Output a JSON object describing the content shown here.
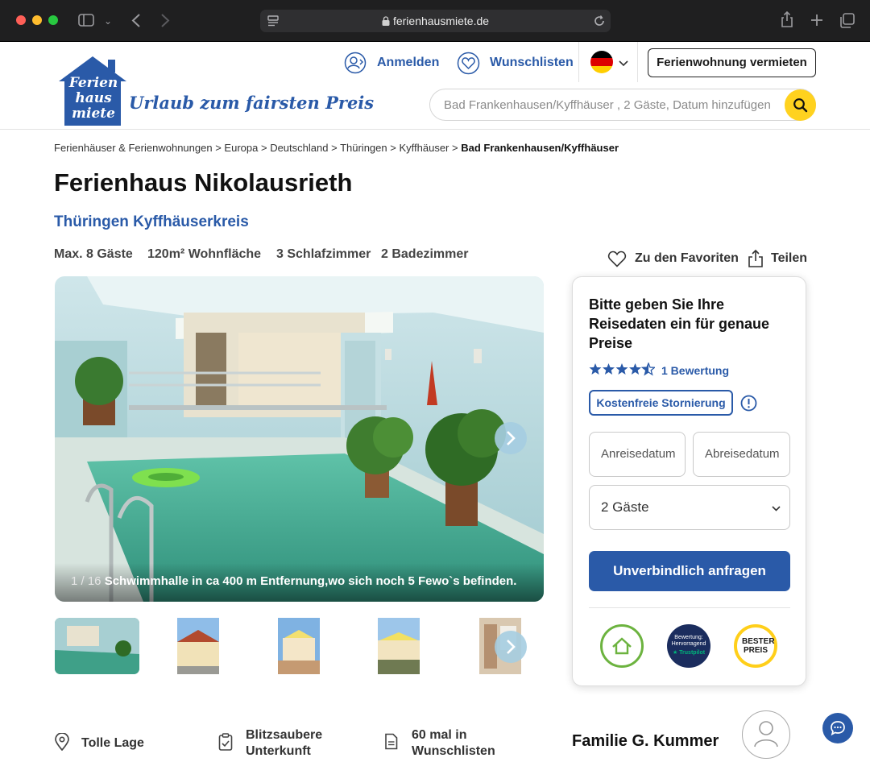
{
  "browser": {
    "url": "ferienhausmiete.de"
  },
  "header": {
    "logo": {
      "wordmark": "Ferien haus miete",
      "tagline": "Urlaub zum fairsten Preis"
    },
    "login_label": "Anmelden",
    "wishlist_label": "Wunschlisten",
    "language_flag": "flag-de-icon",
    "rent_out_label": "Ferienwohnung vermieten",
    "search_placeholder": "Bad Frankenhausen/Kyffhäuser , 2 Gäste, Datum hinzufügen"
  },
  "breadcrumb": {
    "items": [
      "Ferienhäuser & Ferienwohnungen",
      "Europa",
      "Deutschland",
      "Thüringen",
      "Kyffhäuser"
    ],
    "current": "Bad Frankenhausen/Kyffhäuser",
    "separator": ">"
  },
  "listing": {
    "title": "Ferienhaus Nikolausrieth",
    "region": "Thüringen Kyffhäuserkreis",
    "facts": [
      "Max. 8  Gäste",
      "120m²  Wohnfläche",
      "3 Schlafzimmer",
      "2  Badezimmer"
    ],
    "favorite_label": "Zu den Favoriten",
    "share_label": "Teilen"
  },
  "gallery": {
    "counter": "1 / 16",
    "caption": "Schwimmhalle in ca 400 m Entfernung,wo sich noch 5 Fewo`s befinden."
  },
  "booking": {
    "title": "Bitte geben Sie Ihre Reisedaten ein für genaue Preise",
    "rating": 4.5,
    "reviews_label": "1 Bewertung",
    "free_cancel_label": "Kostenfreie Stornierung",
    "checkin_placeholder": "Anreisedatum",
    "checkout_placeholder": "Abreisedatum",
    "guests_value": "2 Gäste",
    "cta_label": "Unverbindlich anfragen",
    "badges": [
      {
        "name": "quality-seal",
        "text": ""
      },
      {
        "name": "trustpilot",
        "text": "Bewertung: Hervorragend",
        "sub": "Trustpilot"
      },
      {
        "name": "best-price",
        "text": "BESTER PREIS"
      }
    ]
  },
  "features": [
    {
      "icon": "location-pin-icon",
      "label": "Tolle Lage"
    },
    {
      "icon": "clipboard-check-icon",
      "label": "Blitzsaubere Unterkunft"
    },
    {
      "icon": "document-icon",
      "label": "60 mal in Wunschlisten"
    }
  ],
  "host": {
    "name": "Familie G. Kummer"
  },
  "colors": {
    "brand_blue": "#2a5aa8",
    "search_yellow": "#ffd21f"
  }
}
